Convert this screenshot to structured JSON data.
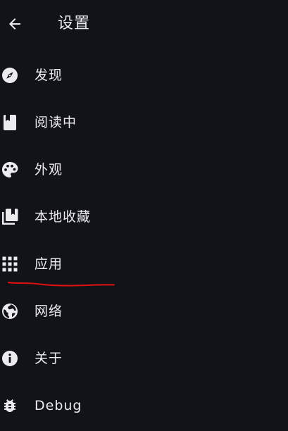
{
  "header": {
    "back_icon": "arrow-left-icon",
    "title": "设置"
  },
  "settings": {
    "items": [
      {
        "id": "discover",
        "icon": "compass-icon",
        "label": "发现"
      },
      {
        "id": "reading",
        "icon": "bookmark-book-icon",
        "label": "阅读中"
      },
      {
        "id": "appearance",
        "icon": "palette-icon",
        "label": "外观"
      },
      {
        "id": "local-library",
        "icon": "library-stack-icon",
        "label": "本地收藏"
      },
      {
        "id": "app",
        "icon": "apps-grid-icon",
        "label": "应用"
      },
      {
        "id": "network",
        "icon": "globe-icon",
        "label": "网络"
      },
      {
        "id": "about",
        "icon": "info-icon",
        "label": "关于"
      },
      {
        "id": "debug",
        "icon": "bug-icon",
        "label": "Debug"
      }
    ]
  },
  "colors": {
    "background": "#121318",
    "text": "#ececf0",
    "annotation_stroke": "#e01010"
  }
}
